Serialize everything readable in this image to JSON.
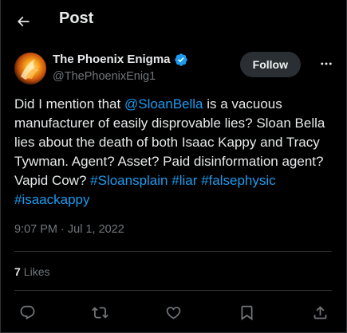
{
  "header": {
    "title": "Post",
    "back_icon": "arrow-left-icon"
  },
  "author": {
    "display_name": "The Phoenix Enigma",
    "handle": "@ThePhoenixEnig1",
    "verified_icon": "verified-badge-icon",
    "follow_label": "Follow",
    "more_icon": "more-horizontal-icon"
  },
  "tweet": {
    "text_1": "Did I mention that ",
    "mention": "@SloanBella",
    "text_2": " is a vacuous manufacturer of easily disprovable lies? Sloan Bella lies about the death of both Isaac Kappy and Tracy Tywman. Agent? Asset? Paid disinformation agent? Vapid Cow? ",
    "hashtag_1": "#Sloansplain",
    "hashtag_2": "#liar",
    "hashtag_3": "#falsephysic",
    "hashtag_4": "#isaackappy",
    "timestamp": "9:07 PM · Jul 1, 2022"
  },
  "stats": {
    "likes_count": "7",
    "likes_label": "Likes"
  },
  "actions": [
    "reply-icon",
    "retweet-icon",
    "like-icon",
    "bookmark-icon",
    "share-icon"
  ],
  "colors": {
    "background": "#000000",
    "text": "#e7e9ea",
    "muted": "#71767b",
    "link": "#1d9bf0",
    "divider": "#2f3336",
    "follow_bg": "#2a2f33"
  }
}
